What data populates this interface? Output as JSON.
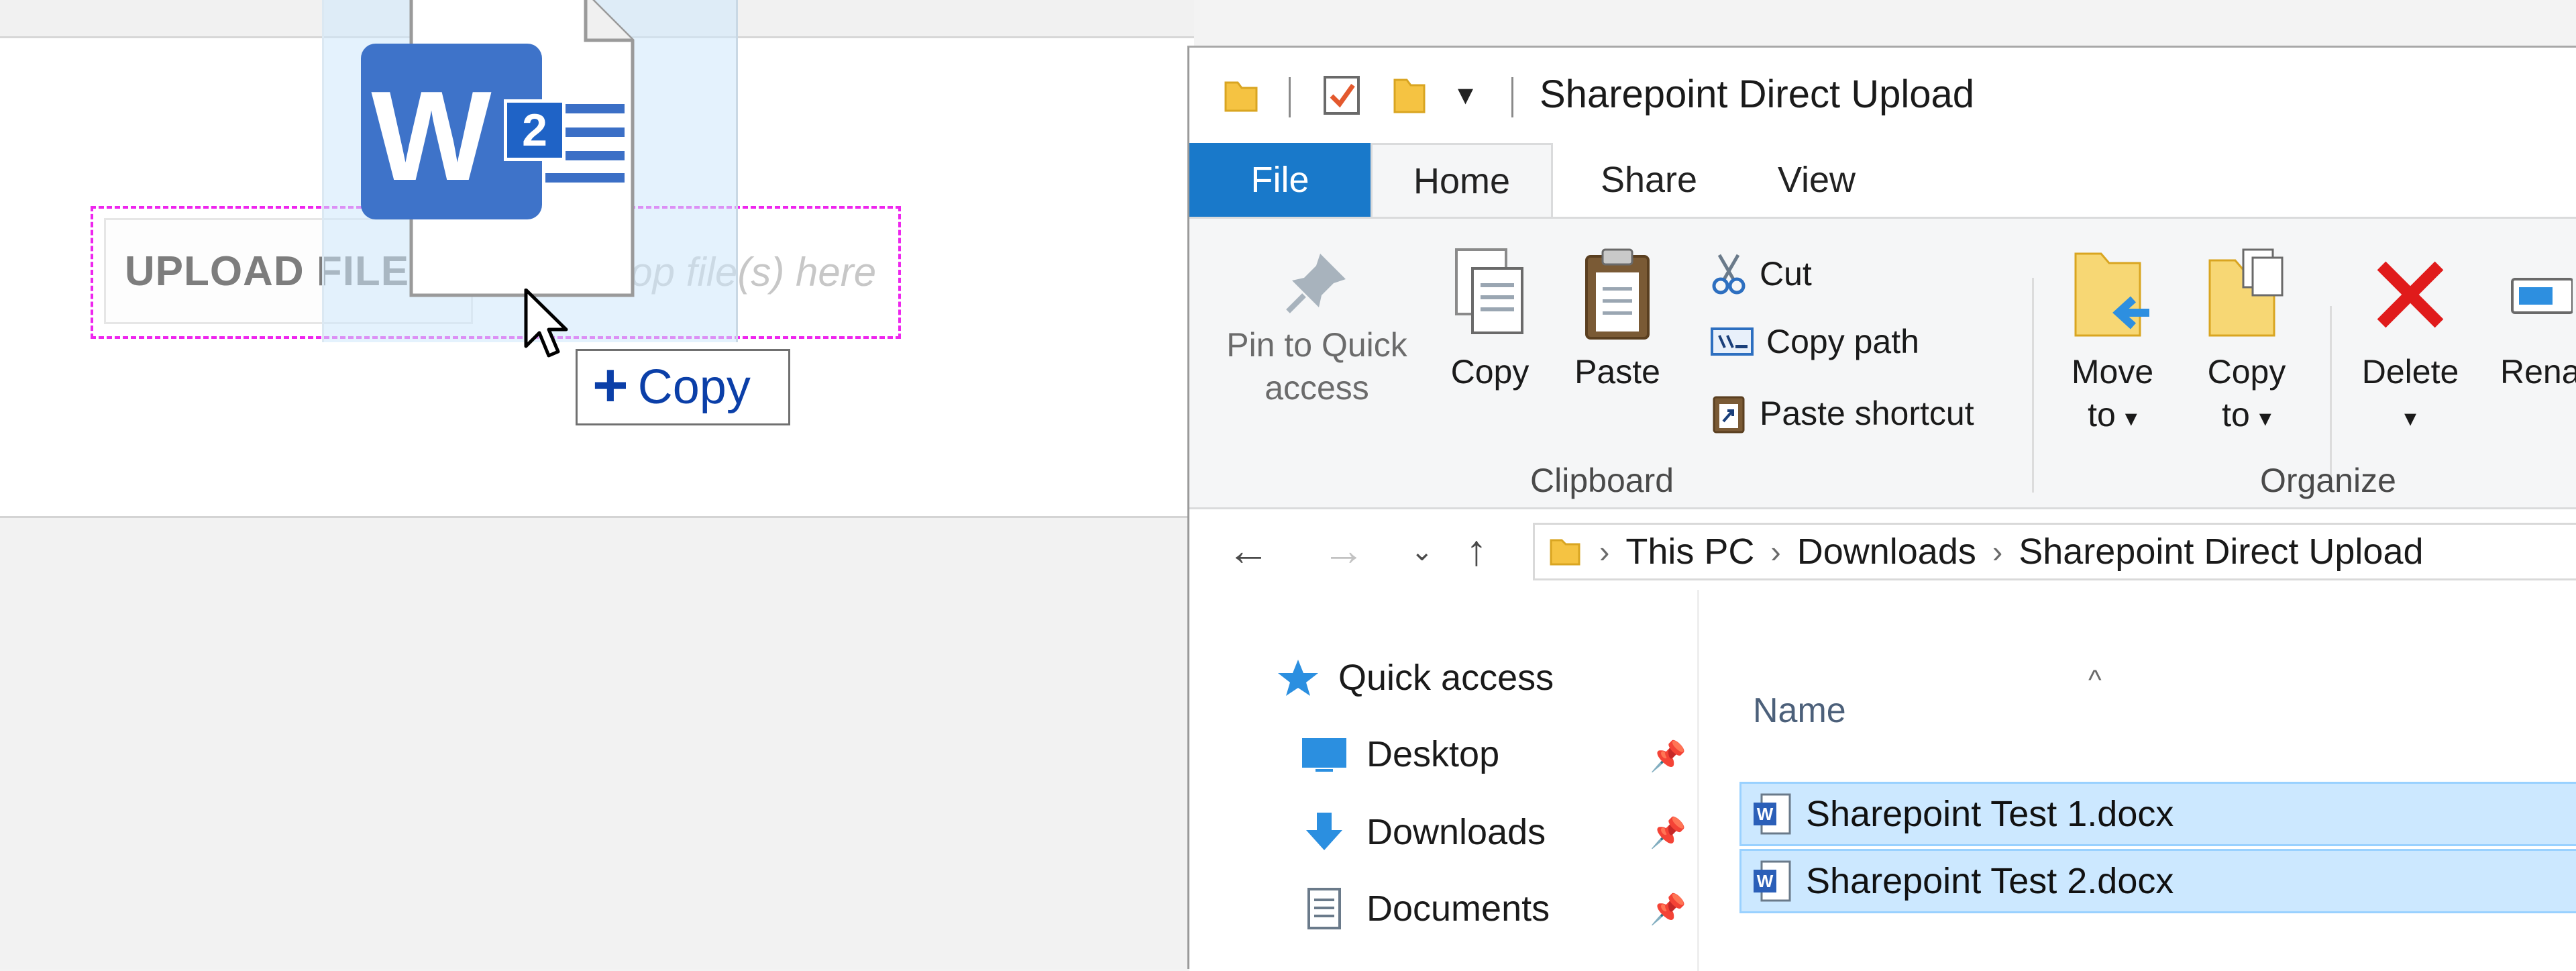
{
  "web": {
    "upload_button_label": "UPLOAD FILES!",
    "drop_hint": "Drop file(s) here",
    "drag_badge_count": "2",
    "drag_tooltip_label": "Copy"
  },
  "explorer": {
    "title": "Sharepoint Direct Upload",
    "tabs": [
      {
        "label": "File"
      },
      {
        "label": "Home"
      },
      {
        "label": "Share"
      },
      {
        "label": "View"
      }
    ],
    "clipboard": {
      "pin_line1": "Pin to Quick",
      "pin_line2": "access",
      "copy": "Copy",
      "paste": "Paste",
      "cut": "Cut",
      "copy_path": "Copy path",
      "paste_shortcut": "Paste shortcut",
      "group_label": "Clipboard"
    },
    "organize": {
      "move_line1": "Move",
      "move_line2": "to",
      "copy_line1": "Copy",
      "copy_line2": "to",
      "delete": "Delete",
      "rename": "Renam",
      "group_label": "Organize"
    },
    "breadcrumb": [
      "This PC",
      "Downloads",
      "Sharepoint Direct Upload"
    ],
    "nav_pane": {
      "quick_access": "Quick access",
      "items": [
        {
          "label": "Desktop"
        },
        {
          "label": "Downloads"
        },
        {
          "label": "Documents"
        }
      ]
    },
    "file_list": {
      "column_name": "Name",
      "files": [
        {
          "name": "Sharepoint Test 1.docx"
        },
        {
          "name": "Sharepoint Test 2.docx"
        }
      ]
    }
  }
}
